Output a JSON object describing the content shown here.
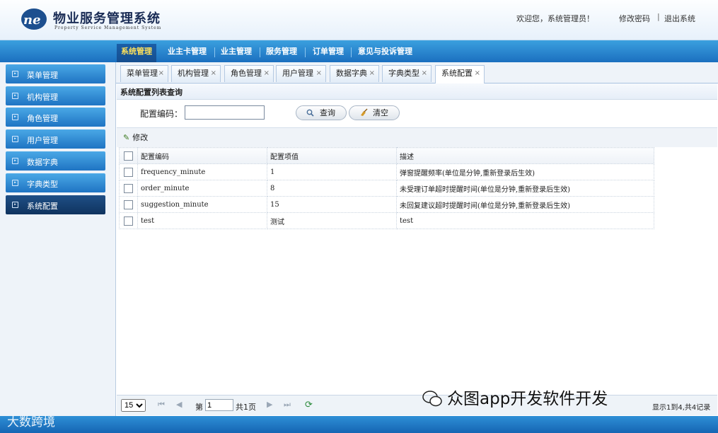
{
  "header": {
    "title": "物业服务管理系统",
    "subtitle": "Property Service Management System",
    "welcome": "欢迎您，系统管理员！",
    "change_password": "修改密码",
    "separator": "|",
    "logout": "退出系统",
    "logo_icon": "ne-logo-icon"
  },
  "topnav": {
    "tabs": [
      {
        "label": "系统管理"
      },
      {
        "label": "业主卡管理"
      },
      {
        "label": "业主管理"
      },
      {
        "label": "服务管理"
      },
      {
        "label": "订单管理"
      },
      {
        "label": "意见与投诉管理"
      }
    ]
  },
  "sidebar": {
    "items": [
      {
        "label": "菜单管理"
      },
      {
        "label": "机构管理"
      },
      {
        "label": "角色管理"
      },
      {
        "label": "用户管理"
      },
      {
        "label": "数据字典"
      },
      {
        "label": "字典类型"
      },
      {
        "label": "系统配置"
      }
    ]
  },
  "page_tabs": [
    {
      "label": "菜单管理"
    },
    {
      "label": "机构管理"
    },
    {
      "label": "角色管理"
    },
    {
      "label": "用户管理"
    },
    {
      "label": "数据字典"
    },
    {
      "label": "字典类型"
    },
    {
      "label": "系统配置"
    }
  ],
  "tab_close": "×",
  "panel": {
    "title": "系统配置列表查询"
  },
  "search": {
    "code_label": "配置编码：",
    "code_value": "",
    "query_button": "查询",
    "clear_button": "清空"
  },
  "toolbar": {
    "edit_label": "修改"
  },
  "table": {
    "headers": [
      "配置编码",
      "配置项值",
      "描述"
    ],
    "rows": [
      {
        "code": "frequency_minute",
        "value": "1",
        "desc": "弹窗提醒频率(单位是分钟,重新登录后生效)"
      },
      {
        "code": "order_minute",
        "value": "8",
        "desc": "未受理订单超时提醒时间(单位是分钟,重新登录后生效)"
      },
      {
        "code": "suggestion_minute",
        "value": "15",
        "desc": "未回复建议超时提醒时间(单位是分钟,重新登录后生效)"
      },
      {
        "code": "test",
        "value": "测试",
        "desc": "test"
      }
    ]
  },
  "pager": {
    "page_size": "15",
    "page_prefix": "第",
    "page_value": "1",
    "page_suffix": "共1页",
    "records": "显示1到4,共4记录"
  },
  "watermarks": {
    "right": "众图app开发软件开发",
    "left": "大数跨境"
  },
  "colors": {
    "nav_blue": "#1b6fbf",
    "active_yellow": "#ffe15a",
    "sidebar_active": "#0f335f"
  }
}
